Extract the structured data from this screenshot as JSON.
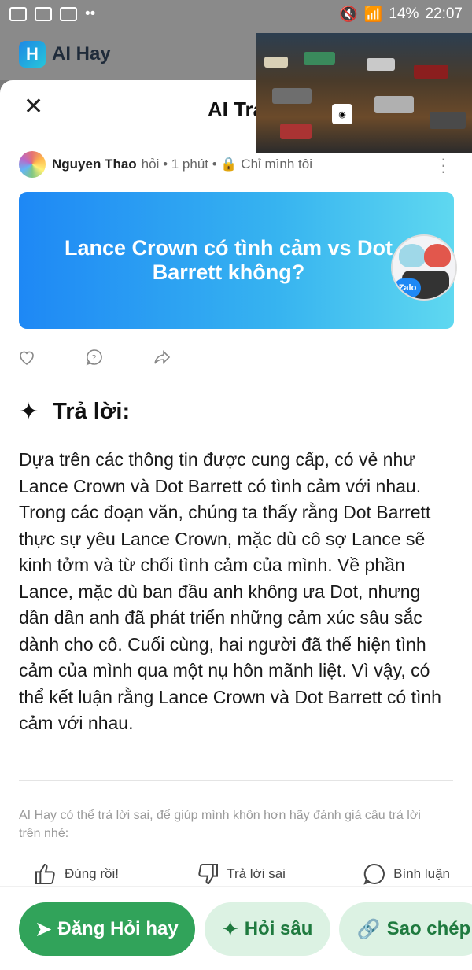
{
  "status": {
    "left_icons": [
      "gallery-icon",
      "youtube-icon",
      "zalo-icon"
    ],
    "dots": "••",
    "battery": "14%",
    "time": "22:07"
  },
  "app": {
    "name": "AI Hay",
    "logo_letter": "H"
  },
  "sheet": {
    "title": "AI Trả"
  },
  "post": {
    "author": "Nguyen Thao",
    "meta": "hỏi • 1 phút • 🔒 Chỉ mình tôi",
    "question": "Lance Crown có tình cảm vs Dot Barrett không?",
    "sticker_label": "Zalo"
  },
  "answer": {
    "heading": "Trả lời:",
    "text": "Dựa trên các thông tin được cung cấp, có vẻ như Lance Crown và Dot Barrett có tình cảm với nhau. Trong các đoạn văn, chúng ta thấy rằng Dot Barrett thực sự yêu Lance Crown, mặc dù cô sợ Lance sẽ kinh tởm và từ chối tình cảm của mình. Về phần Lance, mặc dù ban đầu anh không ưa Dot, nhưng dần dần anh đã phát triển những cảm xúc sâu sắc dành cho cô. Cuối cùng, hai người đã thể hiện tình cảm của mình qua một nụ hôn mãnh liệt. Vì vậy, có thể kết luận rằng Lance Crown và Dot Barrett có tình cảm với nhau."
  },
  "disclaimer": "AI Hay có thể trả lời sai, để giúp mình khôn hơn hãy đánh giá câu trả lời trên nhé:",
  "feedback": {
    "correct": "Đúng rồi!",
    "wrong": "Trả lời sai",
    "comment": "Bình luận"
  },
  "buttons": {
    "post": "Đăng Hỏi hay",
    "deep": "Hỏi sâu",
    "copy": "Sao chép"
  },
  "colors": {
    "primary": "#31a35a",
    "soft": "#dcf2e3",
    "card_start": "#1e88f5",
    "card_end": "#5fd8f0"
  }
}
